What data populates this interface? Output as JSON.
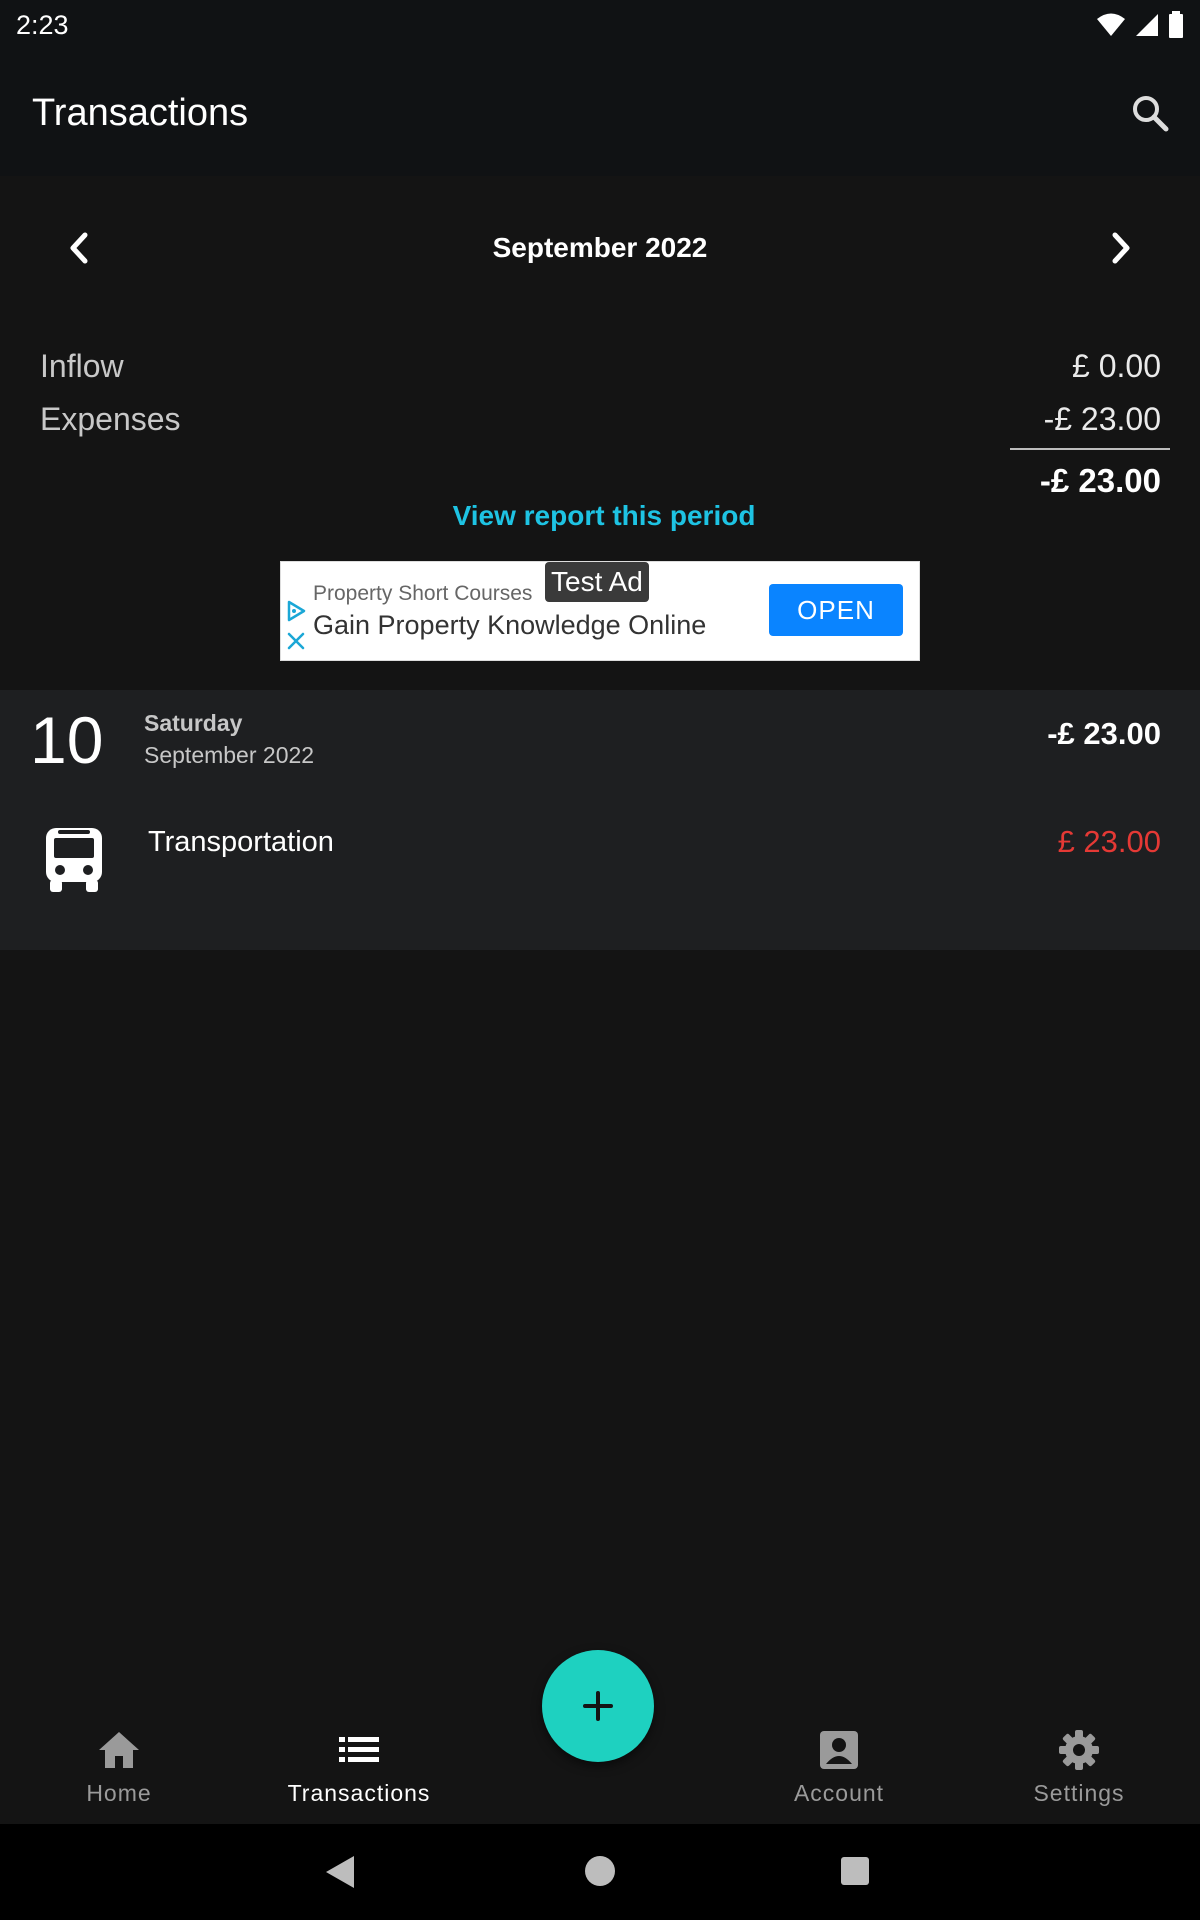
{
  "status_bar": {
    "time": "2:23",
    "icons": [
      "wifi-icon",
      "signal-icon",
      "battery-icon"
    ]
  },
  "app_bar": {
    "title": "Transactions",
    "search_icon": "search-icon"
  },
  "period": {
    "label": "September 2022",
    "prev_icon": "chevron-left-icon",
    "next_icon": "chevron-right-icon"
  },
  "summary": {
    "inflow_label": "Inflow",
    "inflow_value": "£ 0.00",
    "expenses_label": "Expenses",
    "expenses_value": "-£ 23.00",
    "total": "-£ 23.00"
  },
  "report_link": "View report this period",
  "ad": {
    "badge": "Test Ad",
    "subtitle": "Property Short Courses",
    "headline": "Gain Property Knowledge Online",
    "cta": "OPEN"
  },
  "day_group": {
    "day_number": "10",
    "weekday": "Saturday",
    "month_year": "September 2022",
    "total": "-£ 23.00",
    "transactions": [
      {
        "icon": "bus-icon",
        "category": "Transportation",
        "amount": "£ 23.00"
      }
    ]
  },
  "fab": {
    "icon": "plus-icon"
  },
  "bottom_nav": {
    "items": [
      {
        "label": "Home",
        "icon": "home-icon",
        "active": false
      },
      {
        "label": "Transactions",
        "icon": "list-icon",
        "active": true
      },
      {
        "label": "Account",
        "icon": "account-box-icon",
        "active": false
      },
      {
        "label": "Settings",
        "icon": "gear-icon",
        "active": false
      }
    ]
  },
  "colors": {
    "background": "#141414",
    "accent_link": "#1ec3e3",
    "fab": "#1ed1c0",
    "expense_red": "#e53935"
  }
}
